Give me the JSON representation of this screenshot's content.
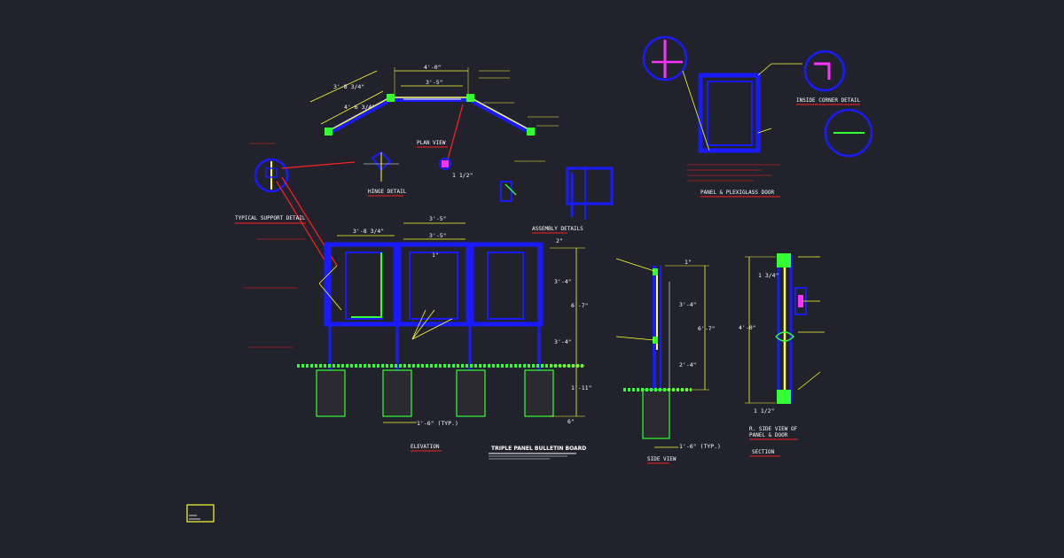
{
  "drawing": {
    "title": "TRIPLE PANEL BULLETIN BOARD",
    "colors": {
      "background": "#21222c",
      "blue": "#1a1aff",
      "yellow": "#ffff33",
      "white": "#ffffff",
      "red": "#ff2020",
      "green": "#33ff33",
      "magenta": "#ff33ff"
    },
    "view_labels": {
      "plan": "PLAN VIEW",
      "elevation": "ELEVATION",
      "side": "SIDE VIEW",
      "section": "SECTION",
      "hinge_detail": "HINGE DETAIL",
      "typical_support": "TYPICAL SUPPORT DETAIL",
      "assembly": "ASSEMBLY DETAILS",
      "inside_corner": "INSIDE CORNER DETAIL",
      "panel_door": "PANEL & PLEXIGLASS DOOR",
      "r_side_view": "R. SIDE VIEW OF",
      "r_side_view_2": "PANEL & DOOR"
    },
    "dimensions": {
      "plan_center": "4'-0\"",
      "plan_inner": "3'-5\"",
      "plan_left": "3'-8 3/4\"",
      "plan_left2": "4'-6 3/4\"",
      "elev_top": "3'-5\"",
      "elev_left": "3'-8 3/4\"",
      "elev_mid": "3'-5\"",
      "elev_small": "1\"",
      "elev_h1": "3'-4\"",
      "elev_h2": "6'-7\"",
      "elev_h3": "3'-4\"",
      "elev_h4": "1'-11\"",
      "elev_h5": "2\"",
      "elev_h6": "6\"",
      "elev_footing": "1'-6\" (TYP.)",
      "side_top": "1\"",
      "side_h1": "3'-4\"",
      "side_h2": "6'-7\"",
      "side_h3": "2'-4\"",
      "side_footing": "1'-6\" (TYP.)",
      "section_top": "1 3/4\"",
      "section_h": "4'-0\"",
      "section_bottom": "1 1/2\"",
      "hinge_dim": "1 1/2\""
    }
  }
}
